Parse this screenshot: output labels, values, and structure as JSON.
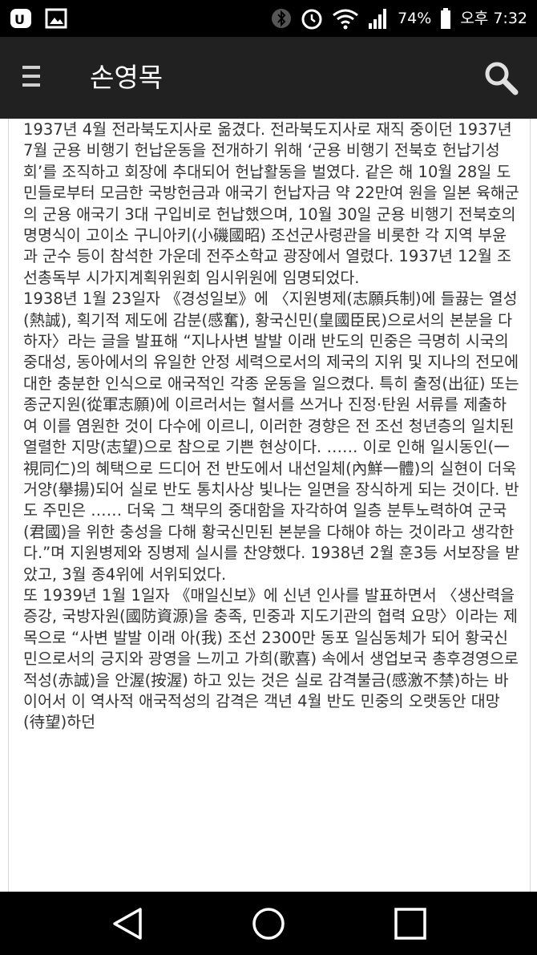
{
  "status_bar": {
    "battery": "74%",
    "time": "오후 7:32"
  },
  "app_bar": {
    "title": "손영목",
    "menu_icon": "menu-icon",
    "search_icon": "search-icon"
  },
  "article": {
    "paragraphs": [
      "1937년 4월 전라북도지사로 옮겼다. 전라북도지사로 재직 중이던 1937년 7월 군용 비행기 헌납운동을 전개하기 위해 ‘군용 비행기 전북호 헌납기성회’를 조직하고 회장에 추대되어 헌납활동을 벌였다. 같은 해 10월 28일 도민들로부터 모금한 국방헌금과 애국기 헌납자금 약 22만여 원을 일본 육해군의 군용 애국기 3대 구입비로 헌납했으며, 10월 30일 군용 비행기 전북호의 명명식이 고이소 구니아키(小磯國昭) 조선군사령관을 비롯한 각 지역 부윤과 군수 등이 참석한 가운데 전주소학교 광장에서 열렸다. 1937년 12월 조선총독부 시가지계획위원회 임시위원에 임명되었다.",
      "1938년 1월 23일자 《경성일보》에 〈지원병제(志願兵制)에 들끓는 열성(熱誠), 획기적 제도에 감분(感奮), 황국신민(皇國臣民)으로서의 본분을 다하자〉라는 글을 발표해 “지나사변 발발 이래 반도의 민중은 극명히 시국의 중대성, 동아에서의 유일한 안정 세력으로서의 제국의 지위 및 지나의 전모에 대한 충분한 인식으로 애국적인 각종 운동을 일으켰다. 특히 출정(出征) 또는 종군지원(從軍志願)에 이르러서는 혈서를 쓰거나 진정·탄원 서류를 제출하여 이를 염원한 것이 다수에 이르니, 이러한 경향은 전 조선 청년층의 일치된 열렬한 지망(志望)으로 참으로 기쁜 현상이다. …… 이로 인해 일시동인(一視同仁)의 혜택으로 드디어 전 반도에서 내선일체(內鮮一體)의 실현이 더욱 거양(擧揚)되어 실로 반도 통치사상 빛나는 일면을 장식하게 되는 것이다. 반도 주민은 …… 더욱 그 책무의 중대함을 자각하여 일층 분투노력하여 군국(君國)을 위한 충성을 다해 황국신민된 본분을 다해야 하는 것이라고 생각한다.”며 지원병제와 징병제 실시를 찬양했다. 1938년 2월 훈3등 서보장을 받았고, 3월 종4위에 서위되었다.",
      "또 1939년 1월 1일자 《매일신보》에 신년 인사를 발표하면서 〈생산력을 증강, 국방자원(國防資源)을 충족, 민중과 지도기관의 협력 요망〉이라는 제목으로 “사변 발발 이래 아(我) 조선 2300만 동포 일심동체가 되어 황국신민으로서의 긍지와 광영을 느끼고 가희(歌喜) 속에서 생업보국 총후경영으로 적성(赤誠)을 안渥(按渥) 하고 있는 것은 실로 감격불금(感激不禁)하는 바이어서 이 역사적 애국적성의 감격은 객년 4월 반도 민중의 오랫동안 대망(待望)하던"
    ]
  }
}
